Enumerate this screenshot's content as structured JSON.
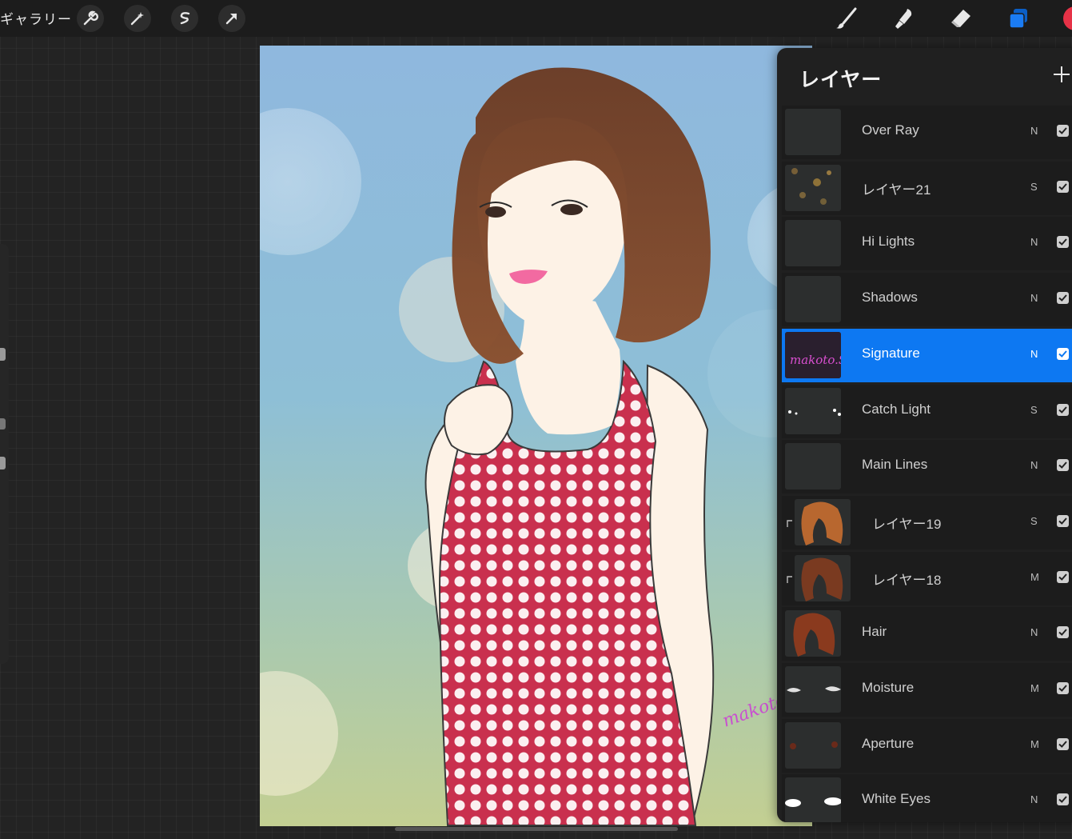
{
  "toolbar": {
    "gallery_label": "ギャラリー",
    "left_tools": [
      "wrench-icon",
      "magic-wand-icon",
      "selection-icon",
      "transform-arrow-icon"
    ],
    "right_tools": [
      "brush-icon",
      "smudge-icon",
      "eraser-icon",
      "layers-icon"
    ],
    "current_color": "#e63247"
  },
  "canvas": {
    "signature_text": "makoto"
  },
  "layers_panel": {
    "title": "レイヤー",
    "add_icon": "plus-icon",
    "layers": [
      {
        "name": "Over Ray",
        "mode": "N",
        "visible": true,
        "selected": false,
        "clipped": false
      },
      {
        "name": "レイヤー21",
        "mode": "S",
        "visible": true,
        "selected": false,
        "clipped": false
      },
      {
        "name": "Hi Lights",
        "mode": "N",
        "visible": true,
        "selected": false,
        "clipped": false
      },
      {
        "name": "Shadows",
        "mode": "N",
        "visible": true,
        "selected": false,
        "clipped": false
      },
      {
        "name": "Signature",
        "mode": "N",
        "visible": true,
        "selected": true,
        "clipped": false
      },
      {
        "name": "Catch Light",
        "mode": "S",
        "visible": true,
        "selected": false,
        "clipped": false
      },
      {
        "name": "Main Lines",
        "mode": "N",
        "visible": true,
        "selected": false,
        "clipped": false
      },
      {
        "name": "レイヤー19",
        "mode": "S",
        "visible": true,
        "selected": false,
        "clipped": true
      },
      {
        "name": "レイヤー18",
        "mode": "M",
        "visible": true,
        "selected": false,
        "clipped": true
      },
      {
        "name": "Hair",
        "mode": "N",
        "visible": true,
        "selected": false,
        "clipped": false
      },
      {
        "name": "Moisture",
        "mode": "M",
        "visible": true,
        "selected": false,
        "clipped": false
      },
      {
        "name": "Aperture",
        "mode": "M",
        "visible": true,
        "selected": false,
        "clipped": false
      },
      {
        "name": "White Eyes",
        "mode": "N",
        "visible": true,
        "selected": false,
        "clipped": false
      }
    ]
  },
  "colors": {
    "accent": "#0d78f2",
    "background": "#232323",
    "panel": "#202020"
  }
}
